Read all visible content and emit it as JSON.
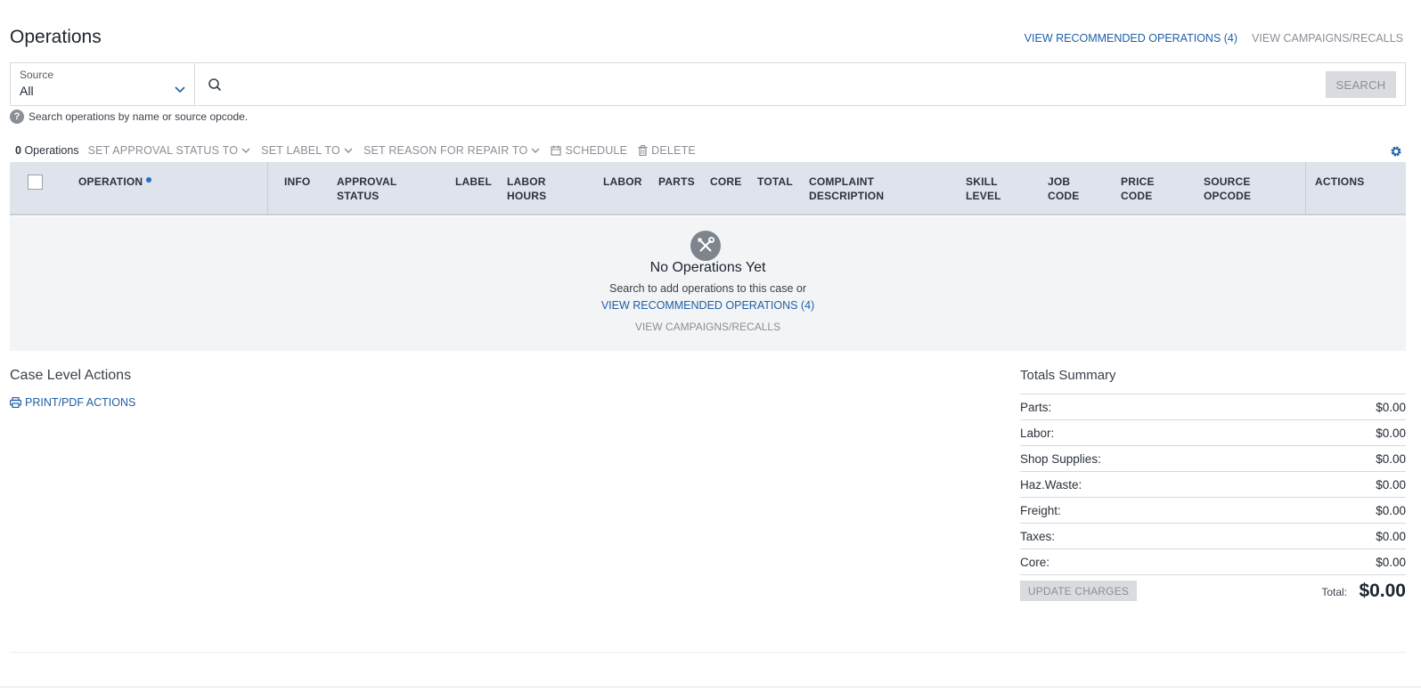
{
  "page": {
    "title": "Operations"
  },
  "top_links": {
    "recommended": "VIEW RECOMMENDED OPERATIONS (4)",
    "campaigns": "VIEW CAMPAIGNS/RECALLS"
  },
  "search": {
    "source_label": "Source",
    "source_value": "All",
    "placeholder": "",
    "button_label": "SEARCH",
    "help_text": "Search operations by name or source opcode."
  },
  "toolbar": {
    "count": "0",
    "count_label": "Operations",
    "set_approval_status": "SET APPROVAL STATUS TO",
    "set_label": "SET LABEL TO",
    "set_reason": "SET REASON FOR REPAIR TO",
    "schedule": "SCHEDULE",
    "delete": "DELETE"
  },
  "table": {
    "columns": {
      "operation": "OPERATION",
      "info": "INFO",
      "approval_1": "APPROVAL",
      "approval_2": "STATUS",
      "label": "LABEL",
      "labor_hours_1": "LABOR",
      "labor_hours_2": "HOURS",
      "labor": "LABOR",
      "parts": "PARTS",
      "core": "CORE",
      "total": "TOTAL",
      "complaint_1": "COMPLAINT",
      "complaint_2": "DESCRIPTION",
      "skill_1": "SKILL",
      "skill_2": "LEVEL",
      "job_1": "JOB",
      "job_2": "CODE",
      "price_1": "PRICE",
      "price_2": "CODE",
      "source_1": "SOURCE",
      "source_2": "OPCODE",
      "actions": "ACTIONS"
    }
  },
  "empty_state": {
    "icon": "tools-icon",
    "title": "No Operations Yet",
    "text": "Search to add operations to this case or",
    "link_recommended": "VIEW RECOMMENDED OPERATIONS (4)",
    "link_campaigns": "VIEW CAMPAIGNS/RECALLS"
  },
  "case_actions": {
    "title": "Case Level Actions",
    "print_label": "PRINT/PDF ACTIONS"
  },
  "totals": {
    "title": "Totals Summary",
    "rows": [
      {
        "label": "Parts:",
        "value": "$0.00"
      },
      {
        "label": "Labor:",
        "value": "$0.00"
      },
      {
        "label": "Shop Supplies:",
        "value": "$0.00"
      },
      {
        "label": "Haz.Waste:",
        "value": "$0.00"
      },
      {
        "label": "Freight:",
        "value": "$0.00"
      },
      {
        "label": "Taxes:",
        "value": "$0.00"
      },
      {
        "label": "Core:",
        "value": "$0.00"
      }
    ],
    "update_button": "UPDATE CHARGES",
    "total_label": "Total:",
    "total_value": "$0.00"
  },
  "colors": {
    "link": "#1f5fa8",
    "muted": "#8a8f96",
    "header_bg": "#dfe4ec",
    "sort_dot": "#1f6fd1"
  }
}
